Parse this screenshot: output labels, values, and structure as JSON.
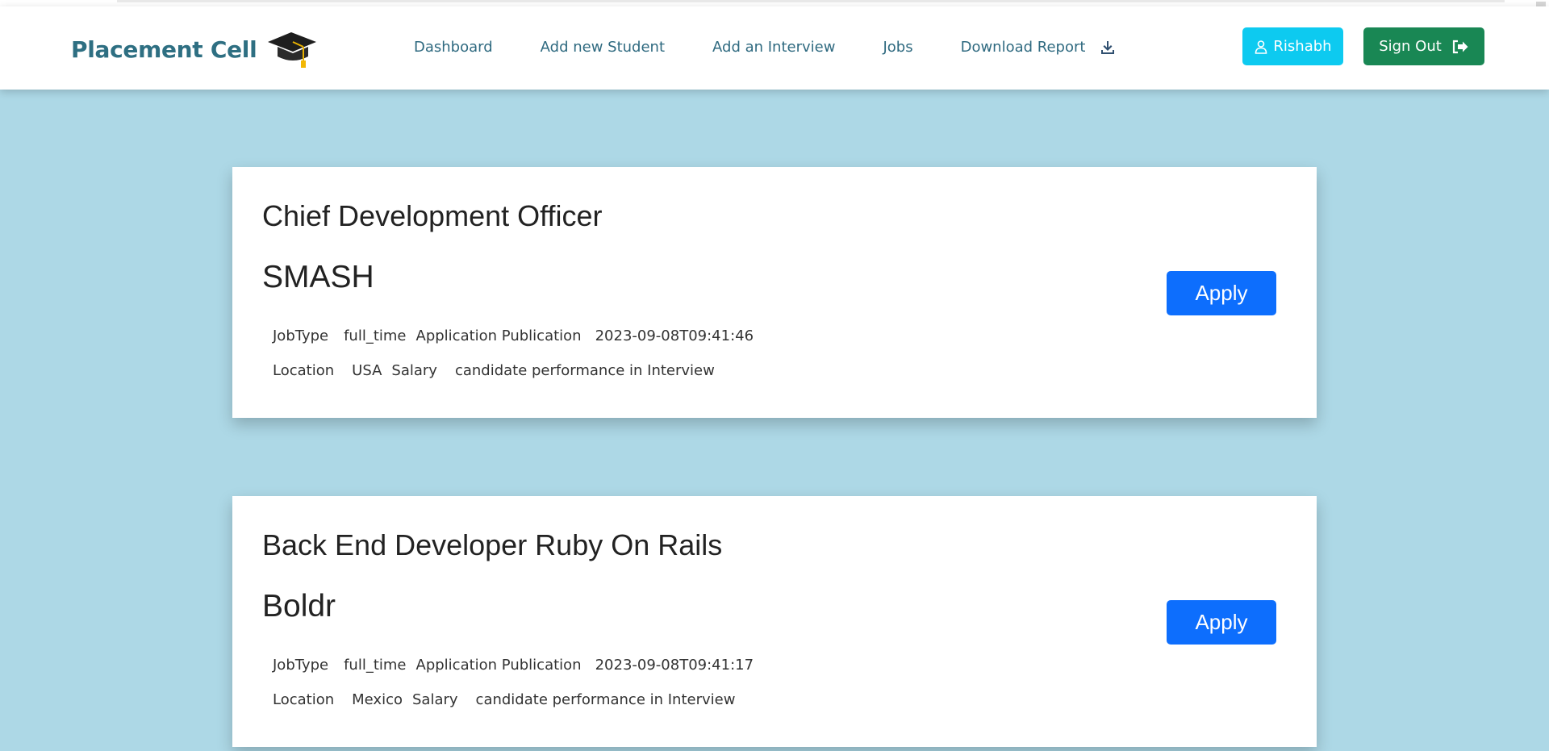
{
  "navbar": {
    "brand": "Placement Cell",
    "links": [
      {
        "label": "Dashboard"
      },
      {
        "label": "Add new Student"
      },
      {
        "label": "Add an Interview"
      },
      {
        "label": "Jobs"
      },
      {
        "label": "Download Report"
      }
    ],
    "user_button": "Rishabh",
    "signout_button": "Sign Out"
  },
  "jobs": [
    {
      "title": "Chief Development Officer",
      "company": "SMASH",
      "jobtype_label": "JobType",
      "jobtype": "full_time",
      "publication_label": "Application Publication",
      "publication": "2023-09-08T09:41:46",
      "location_label": "Location",
      "location": "USA",
      "salary_label": "Salary",
      "salary": "candidate performance in Interview",
      "apply_label": "Apply"
    },
    {
      "title": "Back End Developer Ruby On Rails",
      "company": "Boldr",
      "jobtype_label": "JobType",
      "jobtype": "full_time",
      "publication_label": "Application Publication",
      "publication": "2023-09-08T09:41:17",
      "location_label": "Location",
      "location": "Mexico",
      "salary_label": "Salary",
      "salary": "candidate performance in Interview",
      "apply_label": "Apply"
    }
  ],
  "colors": {
    "page_background": "#add8e6",
    "brand": "#2e6f82",
    "user_button": "#0dcaf0",
    "signout_button": "#198754",
    "apply_button": "#0d6efd"
  },
  "icons": {
    "brand": "graduation-cap-icon",
    "download": "download-icon",
    "user": "user-icon",
    "signout": "sign-out-icon"
  }
}
